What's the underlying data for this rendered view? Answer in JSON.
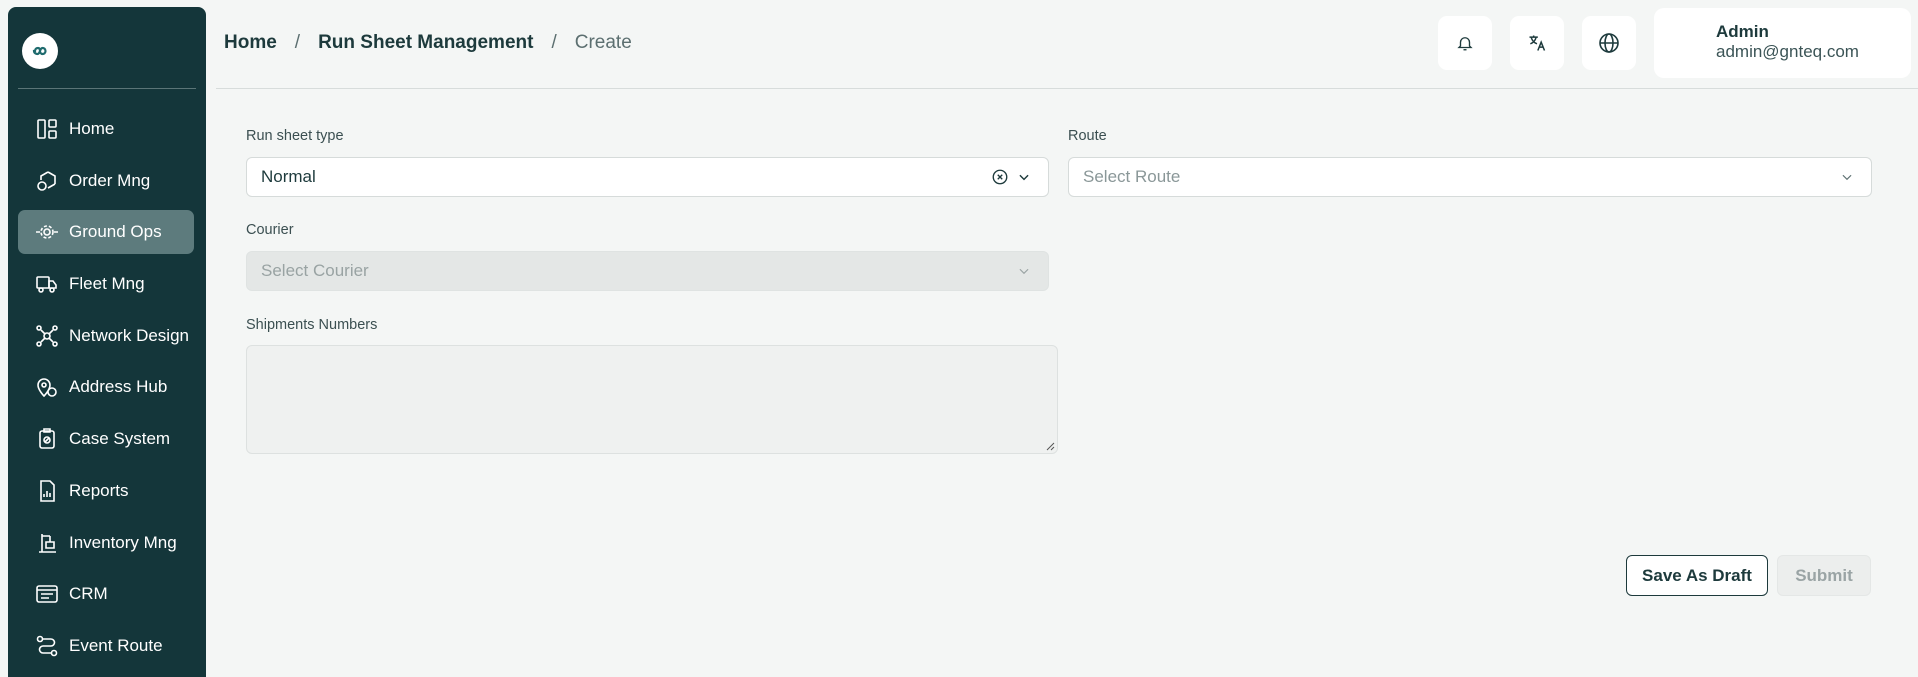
{
  "sidebar": {
    "logo_icon": "infinity-icon",
    "items": [
      {
        "label": "Home",
        "icon": "dashboard-icon",
        "active": false
      },
      {
        "label": "Order Mng",
        "icon": "box-icon",
        "active": false
      },
      {
        "label": "Ground Ops",
        "icon": "gear-icon",
        "active": true
      },
      {
        "label": "Fleet Mng",
        "icon": "truck-icon",
        "active": false
      },
      {
        "label": "Network Design",
        "icon": "network-icon",
        "active": false
      },
      {
        "label": "Address Hub",
        "icon": "location-icon",
        "active": false
      },
      {
        "label": "Case System",
        "icon": "case-icon",
        "active": false
      },
      {
        "label": "Reports",
        "icon": "report-icon",
        "active": false
      },
      {
        "label": "Inventory Mng",
        "icon": "inventory-icon",
        "active": false
      },
      {
        "label": "CRM",
        "icon": "crm-icon",
        "active": false
      },
      {
        "label": "Event Route",
        "icon": "route-icon",
        "active": false
      }
    ]
  },
  "breadcrumb": {
    "items": [
      "Home",
      "Run Sheet Management"
    ],
    "separator": "/",
    "current": "Create"
  },
  "header": {
    "icons": [
      "bell-icon",
      "translate-icon",
      "globe-icon"
    ],
    "user_name": "Admin",
    "user_email": "admin@gnteq.com"
  },
  "form": {
    "run_sheet_type": {
      "label": "Run sheet type",
      "value": "Normal"
    },
    "route": {
      "label": "Route",
      "placeholder": "Select Route"
    },
    "courier": {
      "label": "Courier",
      "placeholder": "Select Courier",
      "disabled": true
    },
    "shipments": {
      "label": "Shipments Numbers",
      "value": ""
    }
  },
  "actions": {
    "save_draft": "Save As Draft",
    "submit": "Submit"
  },
  "colors": {
    "sidebar_bg": "#14363a",
    "active_item_bg": "#5d7b7d",
    "page_bg": "#f4f6f5",
    "text_primary": "#1d3a3c"
  }
}
